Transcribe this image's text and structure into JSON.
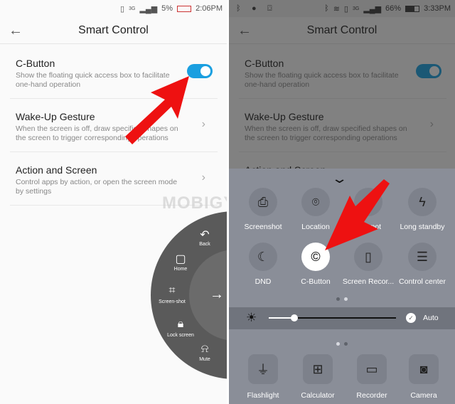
{
  "left_status": {
    "signal": "3G",
    "battery": "5%",
    "time": "2:06PM"
  },
  "right_status": {
    "signal": "3G",
    "battery": "66%",
    "time": "3:33PM"
  },
  "header": {
    "title": "Smart Control",
    "back_icon": "arrow-left-icon"
  },
  "settings": [
    {
      "title": "C-Button",
      "desc": "Show the floating quick access box to facilitate one-hand operation",
      "toggle": true
    },
    {
      "title": "Wake-Up Gesture",
      "desc": "When the screen is off, draw specified shapes on the screen to trigger corresponding operations"
    },
    {
      "title": "Action and Screen",
      "desc": "Control apps by action, or open the screen mode by settings"
    }
  ],
  "cbutton_menu": {
    "items": [
      {
        "label": "Back",
        "icon": "undo-icon"
      },
      {
        "label": "Home",
        "icon": "square-icon"
      },
      {
        "label": "Screen-shot",
        "icon": "crop-icon"
      },
      {
        "label": "Lock screen",
        "icon": "lock-icon"
      },
      {
        "label": "Mute",
        "icon": "bell-off-icon"
      }
    ],
    "center_icon": "arrow-right-icon"
  },
  "quick_tiles": [
    {
      "label": "Screenshot",
      "icon": "screenshot-icon"
    },
    {
      "label": "Location",
      "icon": "location-pin-icon"
    },
    {
      "label": "Hotspot",
      "icon": "hotspot-icon"
    },
    {
      "label": "Long standby",
      "icon": "lightning-icon"
    },
    {
      "label": "DND",
      "icon": "moon-icon"
    },
    {
      "label": "C-Button",
      "icon": "copyright-c-icon",
      "active": true
    },
    {
      "label": "Screen Recor...",
      "icon": "screen-recorder-icon"
    },
    {
      "label": "Control center",
      "icon": "toggles-icon"
    }
  ],
  "brightness": {
    "level": 0.2,
    "auto_label": "Auto",
    "auto": true
  },
  "apps": [
    {
      "label": "Flashlight",
      "icon": "flashlight-icon"
    },
    {
      "label": "Calculator",
      "icon": "calculator-icon"
    },
    {
      "label": "Recorder",
      "icon": "recorder-icon"
    },
    {
      "label": "Camera",
      "icon": "camera-icon"
    }
  ],
  "watermark": "MOBIGYAAN",
  "colors": {
    "accent": "#1a9fe0",
    "arrow": "#ee1111"
  }
}
